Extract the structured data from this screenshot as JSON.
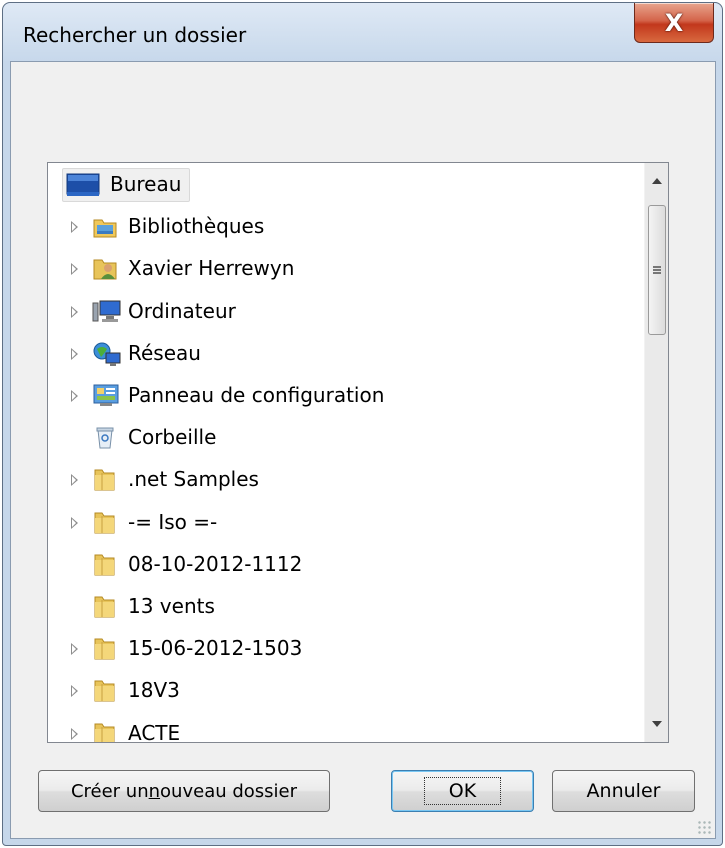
{
  "window": {
    "title": "Rechercher un dossier",
    "close_glyph": "X"
  },
  "tree": {
    "items": [
      {
        "label": "Bureau",
        "icon": "desktop-icon",
        "expandable": false,
        "selected": true,
        "indent": 0
      },
      {
        "label": "Bibliothèques",
        "icon": "libraries-icon",
        "expandable": true,
        "indent": 1
      },
      {
        "label": "Xavier Herrewyn",
        "icon": "user-folder-icon",
        "expandable": true,
        "indent": 1
      },
      {
        "label": "Ordinateur",
        "icon": "computer-icon",
        "expandable": true,
        "indent": 1
      },
      {
        "label": "Réseau",
        "icon": "network-icon",
        "expandable": true,
        "indent": 1
      },
      {
        "label": "Panneau de configuration",
        "icon": "control-panel-icon",
        "expandable": true,
        "indent": 1
      },
      {
        "label": "Corbeille",
        "icon": "recycle-bin-icon",
        "expandable": false,
        "indent": 1
      },
      {
        "label": ".net Samples",
        "icon": "folder-icon",
        "expandable": true,
        "indent": 1
      },
      {
        "label": "-= Iso =-",
        "icon": "folder-icon",
        "expandable": true,
        "indent": 1
      },
      {
        "label": "08-10-2012-1112",
        "icon": "folder-icon",
        "expandable": false,
        "indent": 1
      },
      {
        "label": "13 vents",
        "icon": "folder-icon",
        "expandable": false,
        "indent": 1
      },
      {
        "label": "15-06-2012-1503",
        "icon": "folder-icon",
        "expandable": true,
        "indent": 1
      },
      {
        "label": "18V3",
        "icon": "folder-icon",
        "expandable": true,
        "indent": 1
      },
      {
        "label": "ACTE",
        "icon": "folder-icon",
        "expandable": true,
        "indent": 1
      }
    ]
  },
  "buttons": {
    "new_folder_pre": "Créer un ",
    "new_folder_accel": "n",
    "new_folder_post": "ouveau dossier",
    "ok": "OK",
    "cancel": "Annuler"
  },
  "colors": {
    "frame": "#c6d7ea",
    "close_button": "#c2371c",
    "selection": "#f0f0f0",
    "folder": "#e8c45a"
  }
}
